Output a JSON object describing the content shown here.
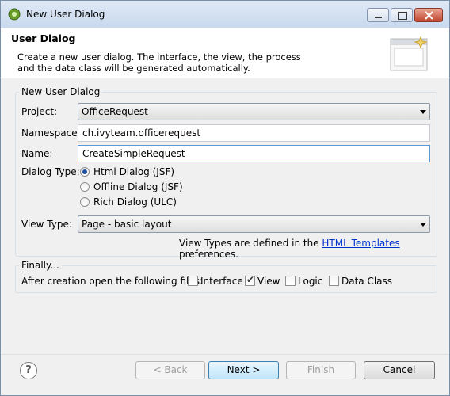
{
  "window": {
    "title": "New User Dialog"
  },
  "banner": {
    "title": "User Dialog",
    "description_line1": "Create a new user dialog. The interface, the view, the process",
    "description_line2": "and the data class will be generated automatically."
  },
  "group": {
    "legend": "New User Dialog",
    "project_label": "Project:",
    "project_value": "OfficeRequest",
    "namespace_label": "Namespace:",
    "namespace_value": "ch.ivyteam.officerequest",
    "name_label": "Name:",
    "name_value": "CreateSimpleRequest",
    "dialog_type_label": "Dialog Type:",
    "dialog_types": [
      {
        "label": "Html Dialog (JSF)",
        "selected": true
      },
      {
        "label": "Offline Dialog (JSF)",
        "selected": false
      },
      {
        "label": "Rich Dialog (ULC)",
        "selected": false
      }
    ],
    "view_type_label": "View Type:",
    "view_type_value": "Page - basic layout",
    "hint_before": "View Types are defined in the",
    "hint_link": "HTML Templates",
    "hint_after": "preferences."
  },
  "finally": {
    "legend": "Finally...",
    "label": "After creation open the following files:",
    "files": [
      {
        "label": "Interface",
        "checked": false
      },
      {
        "label": "View",
        "checked": true
      },
      {
        "label": "Logic",
        "checked": false
      },
      {
        "label": "Data Class",
        "checked": false
      }
    ]
  },
  "buttons": {
    "help": "?",
    "back": "< Back",
    "next": "Next >",
    "finish": "Finish",
    "cancel": "Cancel"
  }
}
